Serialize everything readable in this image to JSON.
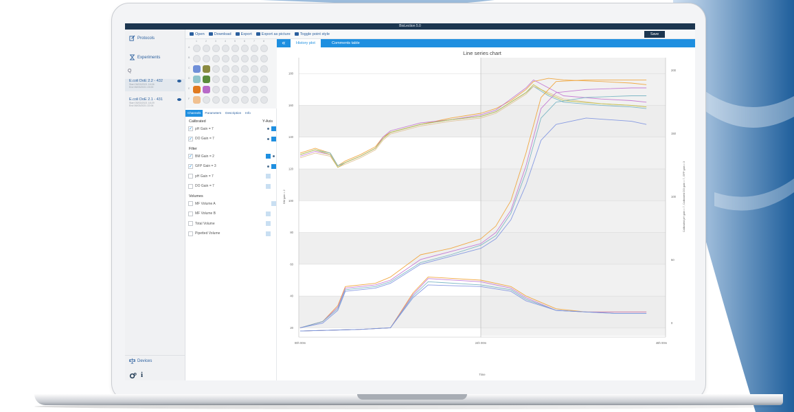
{
  "app": {
    "title": "BioLection 5.0"
  },
  "nav": {
    "protocols": "Protocols",
    "experiments": "Experiments",
    "search_glyph": "Q",
    "items": [
      {
        "name": "E.coli DoE 2.2 - 432",
        "start_label": "Start",
        "start": "06/03/2021 16:06",
        "end_label": "End",
        "end": "06/03/2021 23:00"
      },
      {
        "name": "E.coli DoE 2.1 - 431",
        "start_label": "Start",
        "start": "05/03/2021 18:29",
        "end_label": "End",
        "end": "06/03/2021 22:06"
      }
    ],
    "devices": "Devices",
    "info_glyph": "i"
  },
  "toolbar": {
    "open": "Open",
    "download": "Download",
    "export": "Export",
    "export_picture": "Export as picture",
    "toggle_point": "Toggle point style",
    "save": "Save"
  },
  "plate": {
    "columns": [
      "1",
      "2",
      "3",
      "4",
      "5",
      "6",
      "7",
      "8"
    ],
    "rows": [
      "A",
      "B",
      "C",
      "D",
      "E",
      "F"
    ]
  },
  "channel_tabs": [
    "Channels",
    "Parameters",
    "Description",
    "Info"
  ],
  "channels": {
    "yaxis_title": "Y-Axis",
    "groups": [
      {
        "title": "Calibrated",
        "items": [
          {
            "label": "pH Gain = 7",
            "checked": true,
            "axis": [
              "dot",
              "on"
            ]
          },
          {
            "label": "DO Gain = 7",
            "checked": true,
            "axis": [
              "dot",
              "on"
            ]
          }
        ]
      },
      {
        "title": "Filter",
        "items": [
          {
            "label": "BM Gain = 2",
            "checked": true,
            "axis": [
              "on",
              "dot"
            ]
          },
          {
            "label": "GFP Gain = 3",
            "checked": true,
            "axis": [
              "dot",
              "on"
            ]
          },
          {
            "label": "pH Gain = 7",
            "checked": false,
            "axis": [
              "dim",
              "none"
            ]
          },
          {
            "label": "DO Gain = 7",
            "checked": false,
            "axis": [
              "dim",
              "none"
            ]
          }
        ]
      },
      {
        "title": "Volumes",
        "items": [
          {
            "label": "MF Volume A",
            "checked": false,
            "axis": [
              "none",
              "dim"
            ]
          },
          {
            "label": "MF Volume B",
            "checked": false,
            "axis": [
              "dim",
              "none"
            ]
          },
          {
            "label": "Total Volume",
            "checked": false,
            "axis": [
              "dim",
              "none"
            ]
          },
          {
            "label": "Pipetted Volume",
            "checked": false,
            "axis": [
              "dim",
              "none"
            ]
          }
        ]
      }
    ]
  },
  "chart_tabs": {
    "collapse_glyph": "«",
    "history": "History plot",
    "comments": "Comments table"
  },
  "chart_data": {
    "type": "line",
    "title": "Line series chart",
    "xlabel": "Time",
    "ylabel_left": "BM gain = 2",
    "ylabel_right": "Calibrated pH gain = 7, Calibrated DO gain = 7, GFP gain = 3",
    "x_ticks": [
      "00h 00m",
      "24h 00m",
      "48h 00m"
    ],
    "xlim": [
      0,
      48
    ],
    "y_ticks_left": [
      20,
      40,
      60,
      80,
      100,
      120,
      140,
      160,
      180
    ],
    "ylim_left": [
      15,
      190
    ],
    "y_ticks_right": [
      0,
      50,
      100,
      150,
      200
    ],
    "y_ticks_right_labels": [
      "0",
      "50",
      "100",
      "150",
      "200"
    ],
    "grid": true,
    "band_color": "#ececec",
    "shaded_region_start": 24,
    "series": [
      {
        "color": "#f0a030",
        "x": [
          0,
          2,
          4,
          5,
          6,
          8,
          10,
          11,
          12,
          16,
          20,
          24,
          26,
          28,
          30,
          31,
          33,
          35,
          40,
          44,
          46
        ],
        "y": [
          130,
          133,
          130,
          122,
          125,
          129,
          134,
          140,
          143,
          148,
          152,
          155,
          158,
          163,
          170,
          175,
          177,
          176,
          175,
          174,
          173
        ]
      },
      {
        "color": "#c070d0",
        "x": [
          0,
          2,
          4,
          5,
          6,
          8,
          10,
          11,
          12,
          16,
          20,
          24,
          26,
          28,
          30,
          31,
          33,
          35,
          40,
          44,
          46
        ],
        "y": [
          128,
          131,
          129,
          121,
          124,
          128,
          133,
          140,
          144,
          149,
          151,
          154,
          157,
          164,
          171,
          176,
          171,
          166,
          164,
          163,
          162
        ]
      },
      {
        "color": "#70b0c0",
        "x": [
          0,
          2,
          4,
          5,
          6,
          8,
          10,
          11,
          12,
          16,
          20,
          24,
          26,
          28,
          30,
          31,
          33,
          35,
          40,
          44,
          46
        ],
        "y": [
          129,
          132,
          130,
          122,
          124,
          128,
          133,
          139,
          143,
          148,
          151,
          153,
          156,
          162,
          168,
          172,
          166,
          162,
          160,
          159,
          158
        ]
      },
      {
        "color": "#e0c090",
        "x": [
          0,
          2,
          4,
          5,
          6,
          8,
          10,
          11,
          12,
          16,
          20,
          24,
          26,
          28,
          30,
          31,
          33,
          35,
          40,
          44,
          46
        ],
        "y": [
          127,
          130,
          128,
          121,
          123,
          127,
          132,
          138,
          142,
          147,
          150,
          152,
          155,
          161,
          167,
          172,
          168,
          164,
          161,
          160,
          159
        ]
      },
      {
        "color": "#c0c040",
        "x": [
          0,
          2,
          4,
          5,
          6,
          8,
          10,
          11,
          12,
          16,
          20,
          24,
          26,
          28,
          30,
          31,
          33,
          35,
          40,
          44,
          46
        ],
        "y": [
          129,
          132,
          129,
          121,
          124,
          128,
          133,
          139,
          143,
          148,
          151,
          153,
          156,
          162,
          168,
          173,
          167,
          163,
          161,
          160,
          159
        ]
      },
      {
        "color": "#f0a030",
        "x": [
          0,
          3,
          5,
          6,
          10,
          12,
          16,
          20,
          24,
          26,
          28,
          30,
          32,
          34,
          38,
          44,
          46
        ],
        "y": [
          20,
          24,
          34,
          46,
          48,
          52,
          66,
          70,
          76,
          84,
          100,
          130,
          165,
          175,
          176,
          176,
          176
        ]
      },
      {
        "color": "#c070d0",
        "x": [
          0,
          3,
          5,
          6,
          10,
          12,
          16,
          20,
          24,
          26,
          28,
          30,
          32,
          34,
          38,
          44,
          46
        ],
        "y": [
          20,
          24,
          33,
          45,
          47,
          50,
          63,
          68,
          73,
          80,
          94,
          122,
          158,
          168,
          170,
          171,
          171
        ]
      },
      {
        "color": "#70b0c0",
        "x": [
          0,
          3,
          5,
          6,
          10,
          12,
          16,
          20,
          24,
          26,
          28,
          30,
          32,
          34,
          38,
          44,
          46
        ],
        "y": [
          20,
          24,
          32,
          44,
          46,
          49,
          61,
          66,
          72,
          78,
          92,
          118,
          152,
          162,
          165,
          166,
          166
        ]
      },
      {
        "color": "#7a90e0",
        "x": [
          0,
          3,
          5,
          6,
          10,
          12,
          16,
          20,
          24,
          26,
          28,
          30,
          32,
          34,
          38,
          44,
          46
        ],
        "y": [
          20,
          23,
          31,
          43,
          45,
          48,
          60,
          65,
          70,
          76,
          88,
          110,
          138,
          148,
          152,
          150,
          148
        ]
      },
      {
        "color": "#f0a030",
        "x": [
          0,
          8,
          12,
          15,
          17,
          24,
          28,
          30,
          34,
          38,
          42,
          46
        ],
        "y": [
          18,
          19,
          20,
          42,
          52,
          50,
          46,
          40,
          32,
          30,
          30,
          30
        ]
      },
      {
        "color": "#c070d0",
        "x": [
          0,
          8,
          12,
          15,
          17,
          24,
          28,
          30,
          34,
          38,
          42,
          46
        ],
        "y": [
          18,
          19,
          20,
          41,
          51,
          49,
          45,
          39,
          31,
          30,
          30,
          30
        ]
      },
      {
        "color": "#70b0c0",
        "x": [
          0,
          8,
          12,
          15,
          17,
          24,
          28,
          30,
          34,
          38,
          42,
          46
        ],
        "y": [
          18,
          19,
          20,
          40,
          49,
          47,
          44,
          38,
          31,
          30,
          29,
          29
        ]
      },
      {
        "color": "#7a90e0",
        "x": [
          0,
          8,
          12,
          15,
          17,
          24,
          28,
          30,
          34,
          38,
          42,
          46
        ],
        "y": [
          18,
          19,
          20,
          39,
          47,
          46,
          43,
          37,
          31,
          30,
          29,
          29
        ]
      }
    ]
  },
  "colors": {
    "titlebar": "#1c3650",
    "accent": "#1e8fe0",
    "well_blue": "#6f8fd8",
    "well_olive": "#8a8a40",
    "well_teal": "#8fc4cc",
    "well_green": "#5a8a3a",
    "well_orange": "#e07a20",
    "well_purple": "#b86ac8",
    "well_peach": "#f0c090"
  }
}
